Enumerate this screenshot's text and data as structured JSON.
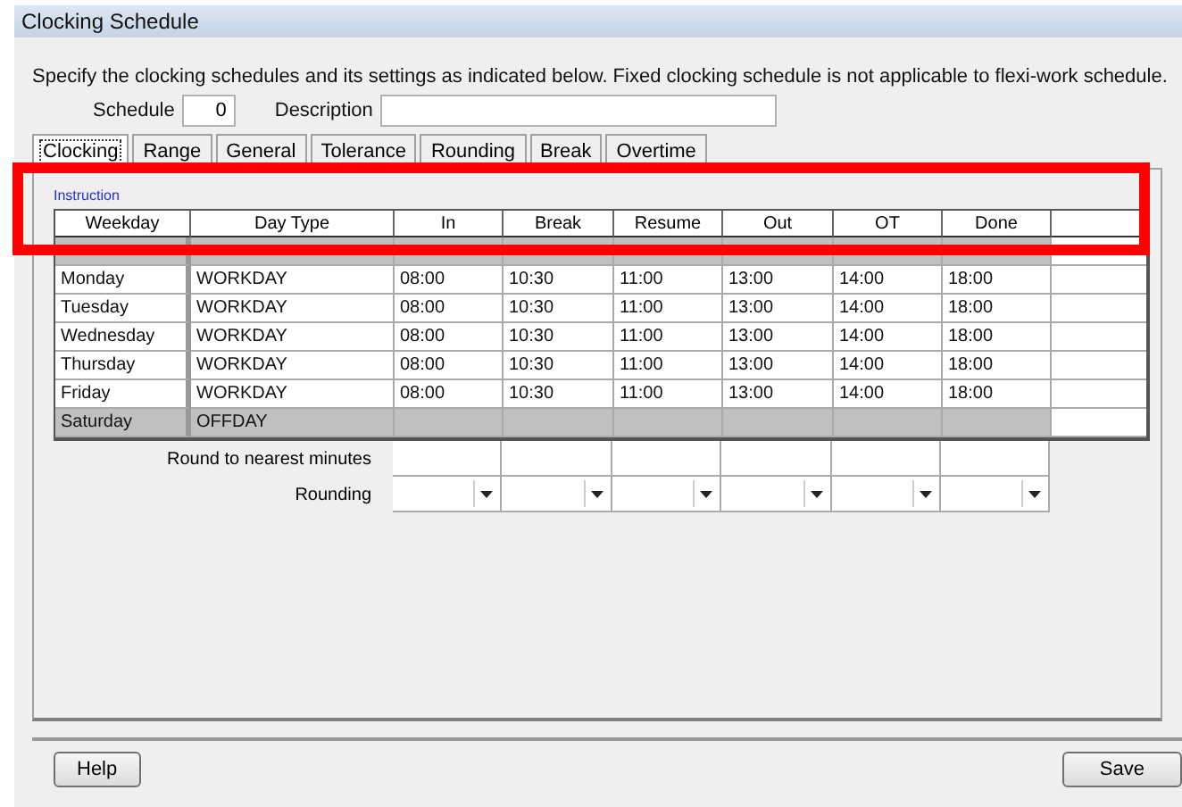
{
  "window": {
    "title": "Clocking Schedule"
  },
  "instruction": "Specify the clocking schedules and its settings as indicated below. Fixed clocking schedule is not applicable to flexi-work schedule.",
  "schedule": {
    "label": "Schedule",
    "value": "0"
  },
  "description": {
    "label": "Description"
  },
  "tabs": [
    {
      "label": "Clocking",
      "selected": true
    },
    {
      "label": "Range",
      "selected": false
    },
    {
      "label": "General",
      "selected": false
    },
    {
      "label": "Tolerance",
      "selected": false
    },
    {
      "label": "Rounding",
      "selected": false
    },
    {
      "label": "Break",
      "selected": false
    },
    {
      "label": "Overtime",
      "selected": false
    }
  ],
  "panel_link": "Instruction",
  "table": {
    "columns": [
      "Weekday",
      "Day Type",
      "In",
      "Break",
      "Resume",
      "Out",
      "OT",
      "Done"
    ],
    "rows": [
      {
        "times": [],
        "off": true
      },
      {
        "weekday": "Monday",
        "day_type": "WORKDAY",
        "times": [
          "08:00",
          "10:30",
          "11:00",
          "13:00",
          "14:00",
          "18:00"
        ],
        "off": false
      },
      {
        "weekday": "Tuesday",
        "day_type": "WORKDAY",
        "times": [
          "08:00",
          "10:30",
          "11:00",
          "13:00",
          "14:00",
          "18:00"
        ],
        "off": false
      },
      {
        "weekday": "Wednesday",
        "day_type": "WORKDAY",
        "times": [
          "08:00",
          "10:30",
          "11:00",
          "13:00",
          "14:00",
          "18:00"
        ],
        "off": false
      },
      {
        "weekday": "Thursday",
        "day_type": "WORKDAY",
        "times": [
          "08:00",
          "10:30",
          "11:00",
          "13:00",
          "14:00",
          "18:00"
        ],
        "off": false
      },
      {
        "weekday": "Friday",
        "day_type": "WORKDAY",
        "times": [
          "08:00",
          "10:30",
          "11:00",
          "13:00",
          "14:00",
          "18:00"
        ],
        "off": false
      },
      {
        "weekday": "Saturday",
        "day_type": "OFFDAY",
        "times": [],
        "off": true
      }
    ]
  },
  "settings_rows": [
    {
      "label": "Round to nearest minutes",
      "kind": "blank"
    },
    {
      "label": "Rounding",
      "kind": "dropdown"
    }
  ],
  "buttons": {
    "help": "Help",
    "save": "Save"
  }
}
